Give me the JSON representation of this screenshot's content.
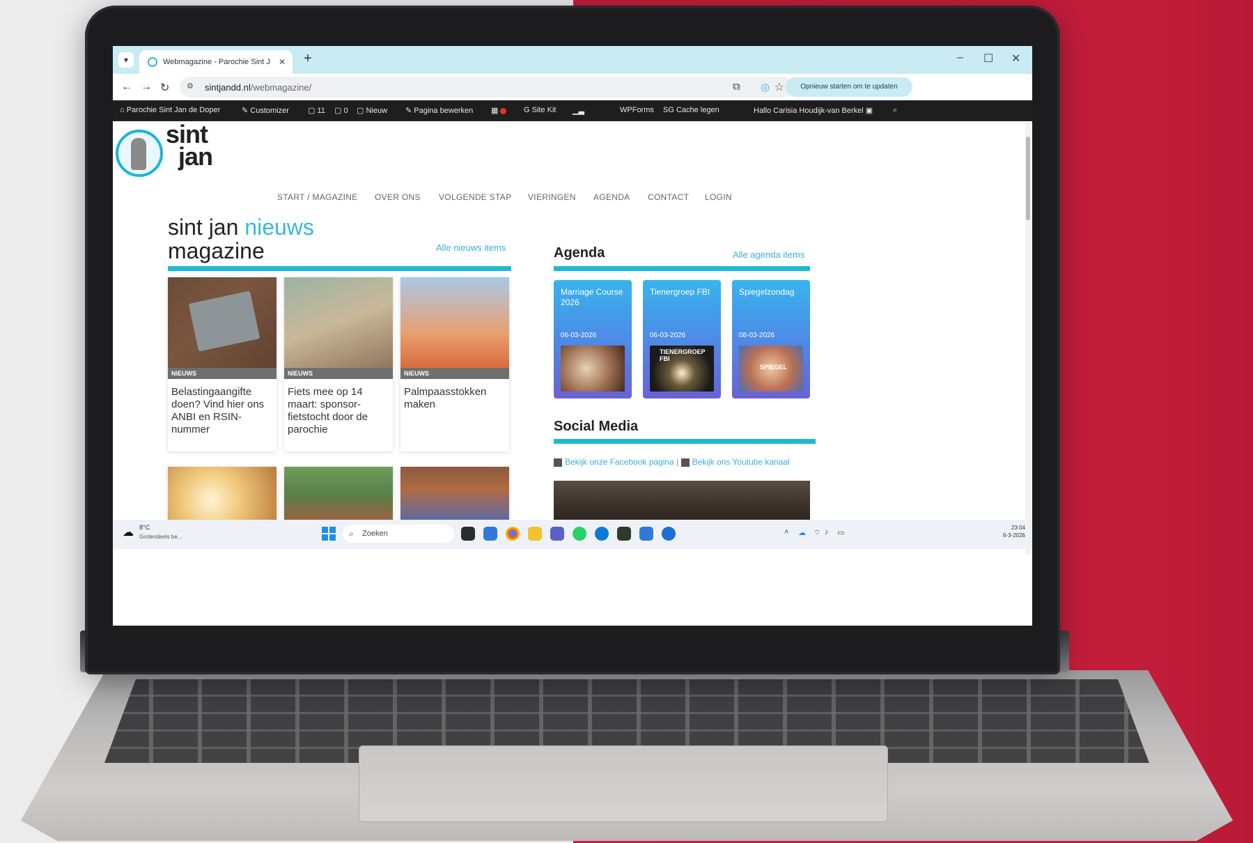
{
  "browser": {
    "tab_title": "Webmagazine - Parochie Sint J",
    "tab_close": "✕",
    "new_tab": "+",
    "url_host": "sintjandd.nl",
    "url_path": "/webmagazine/",
    "update_button": "Opnieuw starten om te updaten",
    "window_controls": [
      "–",
      "☐",
      "✕"
    ]
  },
  "admin_bar": {
    "site_name": "Parochie Sint Jan de Doper",
    "customizer": "Customizer",
    "comments_count": "11",
    "pending_count": "0",
    "new": "Nieuw",
    "edit_page": "Pagina bewerken",
    "site_kit": "Site Kit",
    "wpforms": "WPForms",
    "sg_cache": "SG Cache legen",
    "greeting": "Hallo Carisia Houdijk-van Berkel"
  },
  "site": {
    "logo_line1": "sint",
    "logo_line2": "jan",
    "nav": [
      "START / MAGAZINE",
      "OVER ONS",
      "VOLGENDE STAP",
      "VIERINGEN",
      "AGENDA",
      "CONTACT",
      "LOGIN"
    ]
  },
  "magazine": {
    "title_part1": "sint jan ",
    "title_accent": "nieuws",
    "title_line2": "magazine",
    "all_link": "Alle nieuws items",
    "cards": [
      {
        "category": "NIEUWS",
        "title": "Belastingaangifte doen? Vind hier ons ANBI en RSIN-nummer"
      },
      {
        "category": "NIEUWS",
        "title": "Fiets mee op 14 maart: sponsor-fietstocht door de parochie"
      },
      {
        "category": "NIEUWS",
        "title": "Palmpaasstokken maken"
      }
    ]
  },
  "agenda": {
    "title": "Agenda",
    "all_link": "Alle agenda items",
    "items": [
      {
        "name": "Marriage Course 2026",
        "date": "06-03-2026",
        "thumb_label": ""
      },
      {
        "name": "Tienergroep FBI",
        "date": "06-03-2026",
        "thumb_label": "TIENERGROEP FBI"
      },
      {
        "name": "Spiegelzondag",
        "date": "08-03-2026",
        "thumb_label": "SPIEGEL"
      }
    ]
  },
  "social": {
    "title": "Social Media",
    "facebook_link": "Bekijk onze Facebook pagina",
    "separator": "|",
    "youtube_link": "Bekijk ons Youtube kanaal"
  },
  "taskbar": {
    "weather_temp": "8°C",
    "weather_text": "Grotendeels be...",
    "search_placeholder": "Zoeken",
    "time": "23:04",
    "date": "6-3-2026"
  },
  "colors": {
    "accent": "#1fb8d4",
    "background_red": "#c31f3e",
    "admin_bar": "#1e1e1e"
  }
}
